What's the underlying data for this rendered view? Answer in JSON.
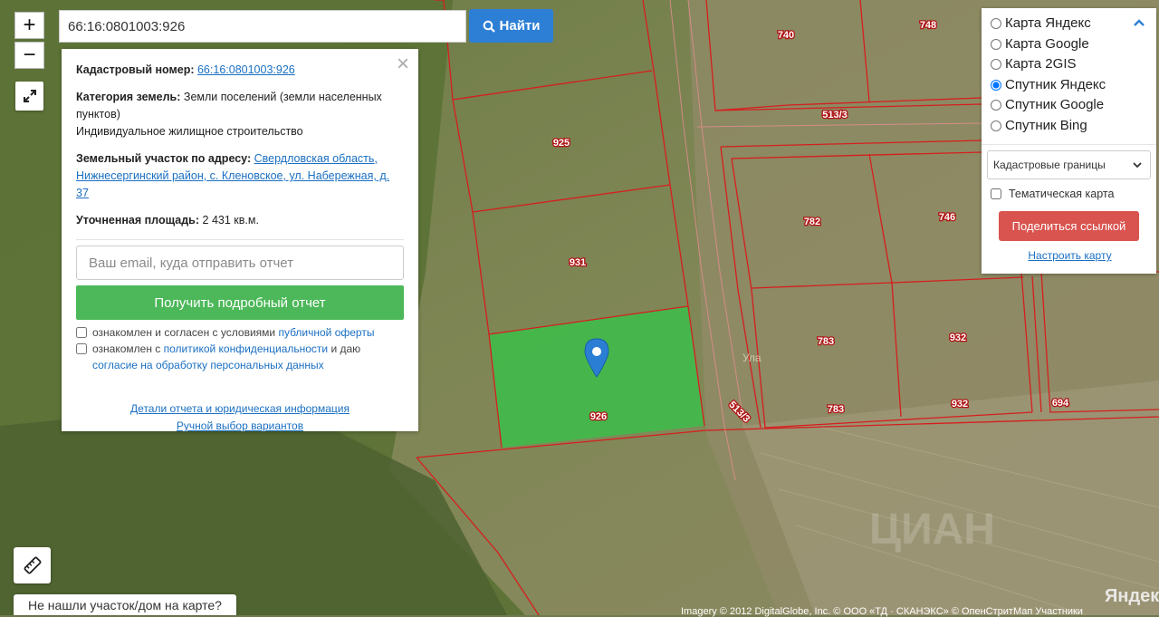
{
  "search": {
    "value": "66:16:0801003:926",
    "button_label": "Найти"
  },
  "zoom": {
    "in_label": "+",
    "out_label": "−"
  },
  "info": {
    "cad_label": "Кадастровый номер:",
    "cad_number": "66:16:0801003:926",
    "category_label": "Категория земель:",
    "category_value": "Земли поселений (земли населенных пунктов)",
    "usage": "Индивидуальное жилищное строительство",
    "address_label": "Земельный участок по адресу:",
    "address_value": "Свердловская область, Нижнесергинский район, с. Кленовское, ул. Набережная, д. 37",
    "area_label": "Уточненная площадь:",
    "area_value": "2 431 кв.м.",
    "email_placeholder": "Ваш email, куда отправить отчет",
    "report_button": "Получить подробный отчет",
    "agree1_text": "ознакомлен и согласен с условиями",
    "agree1_link": "публичной оферты",
    "agree2_text_a": "ознакомлен с",
    "agree2_link_a": "политикой конфиденциальности",
    "agree2_text_b": "и даю",
    "agree2_link_b": "согласие на обработку персональных данных",
    "details_link": "Детали отчета и юридическая информация",
    "manual_link": "Ручной выбор вариантов",
    "close": "×"
  },
  "layers": {
    "options": [
      "Карта Яндекс",
      "Карта Google",
      "Карта 2GIS",
      "Спутник Яндекс",
      "Спутник Google",
      "Спутник Bing"
    ],
    "selected": "Спутник Яндекс",
    "overlay_select": "Кадастровые границы",
    "thematic_label": "Тематическая карта",
    "share_button": "Поделиться ссылкой",
    "configure_link": "Настроить карту"
  },
  "parcels": [
    "740",
    "748",
    "513/3",
    "925",
    "782",
    "746",
    "931",
    "783",
    "932",
    "926",
    "513/3",
    "783",
    "932",
    "694"
  ],
  "map_text": {
    "street": "Ула",
    "watermark": "ЦИАН",
    "copyright": "Imagery © 2012 DigitalGlobe, Inc. © ООО «ТД · СКАНЭКС» © ОпенСтритМап Участники",
    "logo": "Яндекс"
  },
  "bottom": {
    "not_found": "Не нашли участок/дом на карте?"
  },
  "colors": {
    "selected_fill": "#3cbe4a",
    "boundary": "#d61e1e",
    "primary": "#2d7fd6",
    "green_btn": "#4cb859",
    "red_btn": "#d9534f"
  }
}
